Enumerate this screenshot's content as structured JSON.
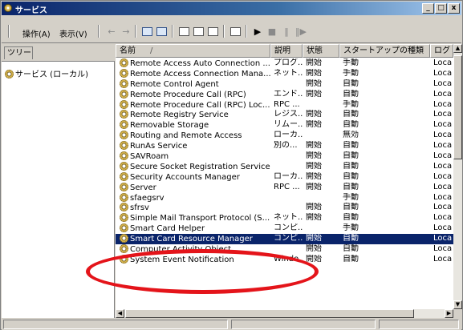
{
  "window": {
    "title": "サービス",
    "controls": {
      "minimize": "_",
      "maximize": "□",
      "close": "x"
    }
  },
  "menu": {
    "items": [
      "操作(A)",
      "表示(V)"
    ]
  },
  "toolbar": {
    "buttons": [
      "back-arrow",
      "forward-arrow",
      "up-level",
      "show-hide-tree",
      "properties",
      "refresh",
      "export-list",
      "help",
      "start-service",
      "stop-service",
      "pause-service",
      "restart-service"
    ]
  },
  "tree": {
    "tab_label": "ツリー",
    "root_label": "サービス (ローカル)"
  },
  "list": {
    "columns": [
      "名前",
      "説明",
      "状態",
      "スタートアップの種類",
      "ログ"
    ],
    "sort_indicator": "/",
    "rows": [
      {
        "name": "Remote Access Auto Connection ...",
        "desc": "プログ...",
        "status": "開始",
        "startup": "手動",
        "logon": "Loca"
      },
      {
        "name": "Remote Access Connection Mana...",
        "desc": "ネット...",
        "status": "開始",
        "startup": "手動",
        "logon": "Loca"
      },
      {
        "name": "Remote Control Agent",
        "desc": "",
        "status": "開始",
        "startup": "自動",
        "logon": "Loca"
      },
      {
        "name": "Remote Procedure Call (RPC)",
        "desc": "エンド...",
        "status": "開始",
        "startup": "自動",
        "logon": "Loca"
      },
      {
        "name": "Remote Procedure Call (RPC) Loc...",
        "desc": "RPC ...",
        "status": "",
        "startup": "手動",
        "logon": "Loca"
      },
      {
        "name": "Remote Registry Service",
        "desc": "レジス...",
        "status": "開始",
        "startup": "自動",
        "logon": "Loca"
      },
      {
        "name": "Removable Storage",
        "desc": "リムー...",
        "status": "開始",
        "startup": "自動",
        "logon": "Loca"
      },
      {
        "name": "Routing and Remote Access",
        "desc": "ローカ...",
        "status": "",
        "startup": "無効",
        "logon": "Loca"
      },
      {
        "name": "RunAs Service",
        "desc": "別の...",
        "status": "開始",
        "startup": "自動",
        "logon": "Loca"
      },
      {
        "name": "SAVRoam",
        "desc": "",
        "status": "開始",
        "startup": "自動",
        "logon": "Loca"
      },
      {
        "name": "Secure Socket Registration Service",
        "desc": "",
        "status": "開始",
        "startup": "自動",
        "logon": "Loca"
      },
      {
        "name": "Security Accounts Manager",
        "desc": "ローカ...",
        "status": "開始",
        "startup": "自動",
        "logon": "Loca"
      },
      {
        "name": "Server",
        "desc": "RPC ...",
        "status": "開始",
        "startup": "自動",
        "logon": "Loca"
      },
      {
        "name": "sfaegsrv",
        "desc": "",
        "status": "",
        "startup": "手動",
        "logon": "Loca"
      },
      {
        "name": "sfrsv",
        "desc": "",
        "status": "開始",
        "startup": "自動",
        "logon": "Loca"
      },
      {
        "name": "Simple Mail Transport Protocol (S...",
        "desc": "ネット...",
        "status": "開始",
        "startup": "自動",
        "logon": "Loca"
      },
      {
        "name": "Smart Card Helper",
        "desc": "コンピ...",
        "status": "",
        "startup": "手動",
        "logon": "Loca"
      },
      {
        "name": "Smart Card Resource Manager",
        "desc": "コンピ...",
        "status": "開始",
        "startup": "自動",
        "logon": "Loca",
        "selected": true
      },
      {
        "name": "Computer Activity Object...",
        "desc": "",
        "status": "開始",
        "startup": "自動",
        "logon": "Loca"
      },
      {
        "name": "System Event Notification",
        "desc": "Windo...",
        "status": "開始",
        "startup": "自動",
        "logon": "Loca"
      }
    ]
  },
  "colors": {
    "selection": "#0a246a",
    "annotation": "#e4141a",
    "chrome": "#d4d0c8"
  }
}
